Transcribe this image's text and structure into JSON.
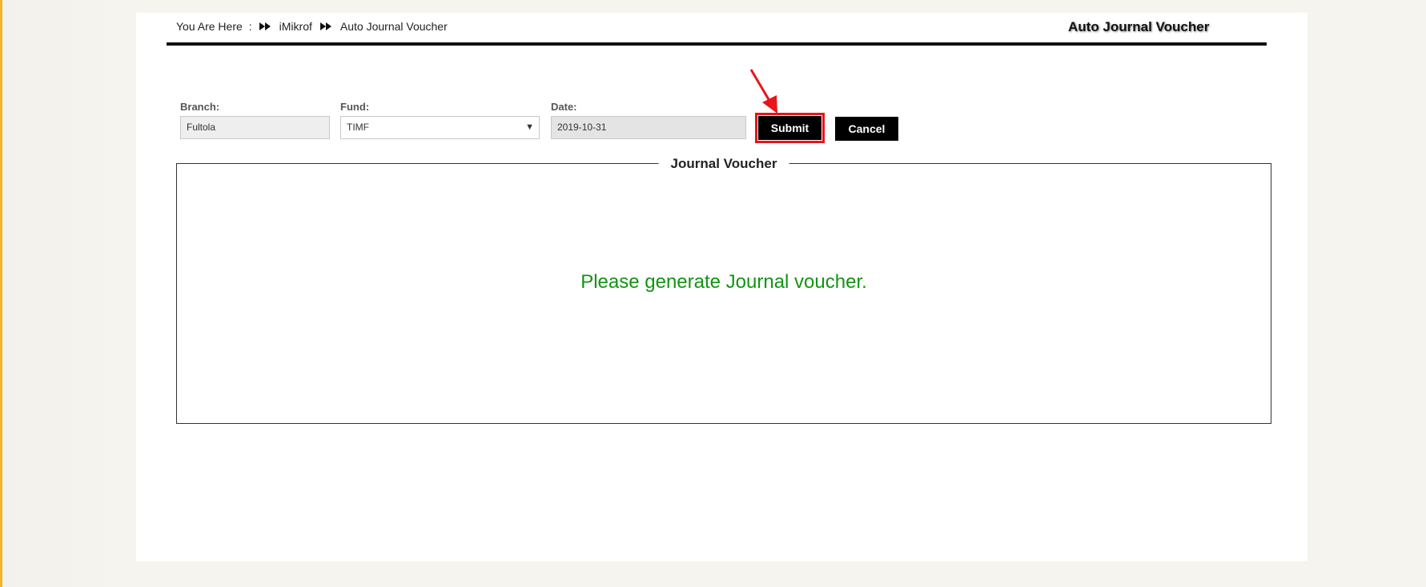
{
  "breadcrumb": {
    "prefix": "You Are Here",
    "separator": ":",
    "items": [
      "iMikrof",
      "Auto Journal Voucher"
    ]
  },
  "page_title": "Auto Journal Voucher",
  "form": {
    "branch": {
      "label": "Branch:",
      "value": "Fultola"
    },
    "fund": {
      "label": "Fund:",
      "value": "TIMF"
    },
    "date": {
      "label": "Date:",
      "value": "2019-10-31"
    },
    "submit_label": "Submit",
    "cancel_label": "Cancel"
  },
  "journal_section": {
    "legend": "Journal Voucher",
    "message": "Please generate Journal voucher."
  },
  "colors": {
    "accent_stripe": "#f0b42a",
    "message_green": "#129412",
    "highlight_red": "#e8141c"
  }
}
